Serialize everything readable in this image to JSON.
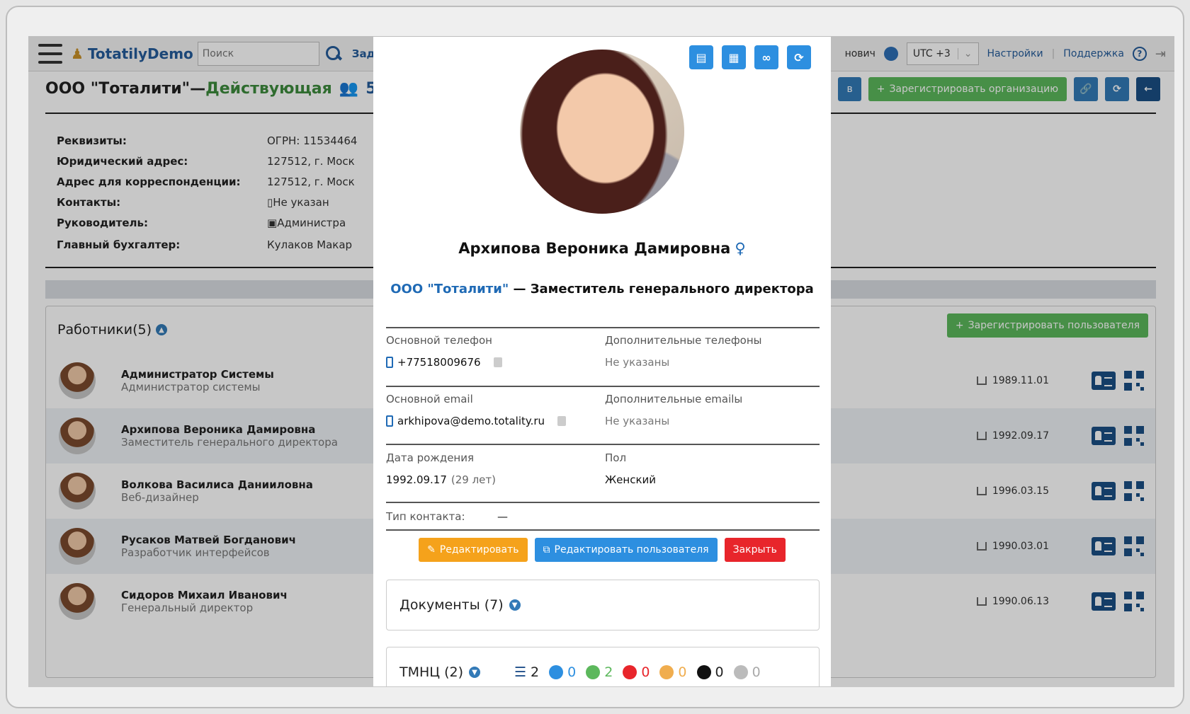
{
  "navbar": {
    "brand": "TotatilyDemo",
    "search_placeholder": "Поиск",
    "tasks_label": "Зада",
    "user_partial": "нович",
    "timezone": "UTC +3",
    "settings": "Настройки",
    "support": "Поддержка"
  },
  "org": {
    "name": "ООО \"Тоталити\"—",
    "status": "Действующая",
    "count": "5",
    "partial_button": "в",
    "register_org_button": "Зарегистрировать организацию"
  },
  "requisites": [
    {
      "label": "Реквизиты:",
      "value": "ОГРН: 11534464"
    },
    {
      "label": "Юридический адрес:",
      "value": "127512, г. Моск"
    },
    {
      "label": "Адрес для корреспонденции:",
      "value": "127512, г. Моск"
    },
    {
      "label": "Контакты:",
      "value": "Не указан"
    },
    {
      "label": "Руководитель:",
      "value": "Администра"
    },
    {
      "label": "Главный бухгалтер:",
      "value": "Кулаков Макар"
    }
  ],
  "workers": {
    "title": "Работники(5)",
    "register_button": "Зарегистрировать пользователя",
    "rows": [
      {
        "name": "Администратор Системы",
        "role": "Администратор системы",
        "date": "1989.11.01"
      },
      {
        "name": "Архипова Вероника Дамировна",
        "role": "Заместитель генерального директора",
        "date": "1992.09.17"
      },
      {
        "name": "Волкова Василиса Данииловна",
        "role": "Веб-дизайнер",
        "date": "1996.03.15"
      },
      {
        "name": "Русаков Матвей Богданович",
        "role": "Разработчик интерфейсов",
        "date": "1990.03.01"
      },
      {
        "name": "Сидоров Михаил Иванович",
        "role": "Генеральный директор",
        "date": "1990.06.13"
      }
    ]
  },
  "modal": {
    "full_name": "Архипова Вероника Дамировна",
    "gender_symbol": "♀",
    "org_link": "ООО \"Тоталити\"",
    "position": " — Заместитель генерального директора",
    "main_phone_label": "Основной телефон",
    "main_phone": "+77518009676",
    "extra_phones_label": "Дополнительные телефоны",
    "extra_phones": "Не указаны",
    "main_email_label": "Основной email",
    "main_email": "arkhipova@demo.totality.ru",
    "extra_emails_label": "Дополнительные emailы",
    "extra_emails": "Не указаны",
    "birth_label": "Дата рождения",
    "birth_date": "1992.09.17",
    "age": "(29 лет)",
    "gender_label": "Пол",
    "gender": "Женский",
    "contact_type_label": "Тип контакта:",
    "contact_type": "—",
    "edit_button": "Редактировать",
    "edit_user_button": "Редактировать пользователя",
    "close_button": "Закрыть",
    "documents_title": "Документы (7)",
    "tmc_title": "ТМНЦ (2)",
    "tmc_counts": {
      "total": "2",
      "blue": "0",
      "green": "2",
      "red": "0",
      "orange": "0",
      "black": "0",
      "gray": "0"
    }
  }
}
